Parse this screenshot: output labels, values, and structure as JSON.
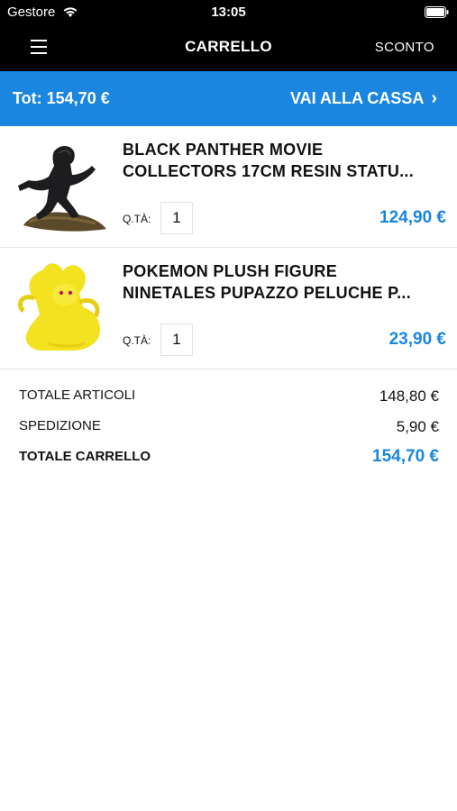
{
  "status": {
    "carrier": "Gestore",
    "time": "13:05"
  },
  "nav": {
    "title": "CARRELLO",
    "discount": "SCONTO"
  },
  "checkout": {
    "total": "Tot: 154,70 €",
    "action": "VAI ALLA CASSA",
    "arrow": "›"
  },
  "items": [
    {
      "line1": "BLACK PANTHER MOVIE",
      "line2": "COLLECTORS 17CM RESIN STATU...",
      "qty_label": "Q.TÀ:",
      "qty": "1",
      "price": "124,90 €"
    },
    {
      "line1": "POKEMON PLUSH FIGURE",
      "line2": "NINETALES PUPAZZO PELUCHE P...",
      "qty_label": "Q.TÀ:",
      "qty": "1",
      "price": "23,90 €"
    }
  ],
  "totals": {
    "items_label": "TOTALE ARTICOLI",
    "items_value": "148,80 €",
    "shipping_label": "SPEDIZIONE",
    "shipping_value": "5,90 €",
    "cart_label": "TOTALE CARRELLO",
    "cart_value": "154,70 €"
  },
  "colors": {
    "accent": "#1a86e0",
    "bar": "#000000"
  }
}
